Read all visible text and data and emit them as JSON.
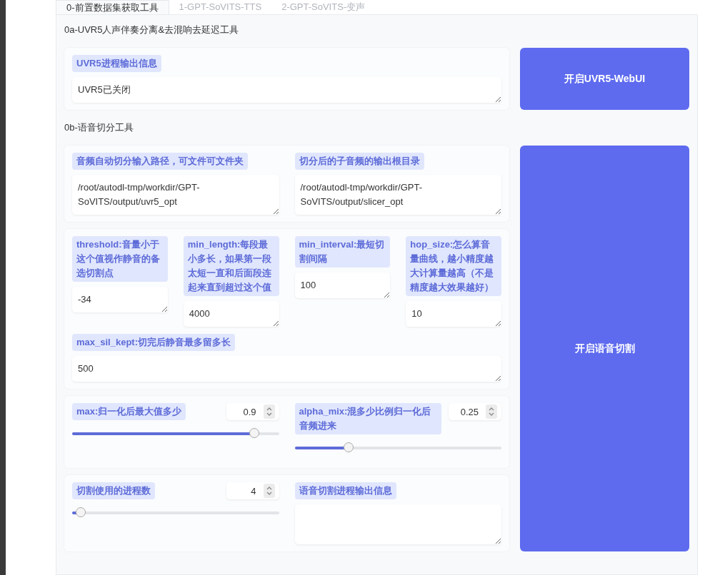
{
  "tabs": [
    {
      "label": "0-前置数据集获取工具",
      "selected": true
    },
    {
      "label": "1-GPT-SoVITS-TTS",
      "selected": false
    },
    {
      "label": "2-GPT-SoVITS-变声",
      "selected": false
    }
  ],
  "sections": [
    {
      "title": "0a-UVR5人声伴奏分离&去混响去延迟工具",
      "button": "开启UVR5-WebUI",
      "groups": [
        [
          [
            {
              "kind": "text",
              "label": "UVR5进程输出信息",
              "value": "UVR5已关闭"
            }
          ]
        ]
      ]
    },
    {
      "title": "0b-语音切分工具",
      "button": "开启语音切割",
      "groups": [
        [
          [
            {
              "kind": "text",
              "label": "音频自动切分输入路径，可文件可文件夹",
              "value": "/root/autodl-tmp/workdir/GPT-SoVITS/output/uvr5_opt"
            },
            {
              "kind": "text",
              "label": "切分后的子音频的输出根目录",
              "value": "/root/autodl-tmp/workdir/GPT-SoVITS/output/slicer_opt"
            }
          ]
        ],
        [
          [
            {
              "kind": "text",
              "label": "threshold:音量小于这个值视作静音的备选切割点",
              "value": "-34"
            },
            {
              "kind": "text",
              "label": "min_length:每段最小多长，如果第一段太短一直和后面段连起来直到超过这个值",
              "value": "4000"
            },
            {
              "kind": "text",
              "label": "min_interval:最短切割间隔",
              "value": "100"
            },
            {
              "kind": "text",
              "label": "hop_size:怎么算音量曲线，越小精度越大计算量越高（不是精度越大效果越好）",
              "value": "10"
            }
          ],
          [
            {
              "kind": "text",
              "label": "max_sil_kept:切完后静音最多留多长",
              "value": "500"
            }
          ]
        ],
        [
          [
            {
              "kind": "slider",
              "label": "max:归一化后最大值多少",
              "value": "0.9",
              "level": 0.88
            },
            {
              "kind": "slider",
              "label": "alpha_mix:混多少比例归一化后音频进来",
              "value": "0.25",
              "level": 0.26
            }
          ]
        ],
        [
          [
            {
              "kind": "slider",
              "label": "切割使用的进程数",
              "value": "4",
              "level": 0.04
            },
            {
              "kind": "text",
              "label": "语音切割进程输出信息"
            }
          ]
        ]
      ]
    }
  ]
}
